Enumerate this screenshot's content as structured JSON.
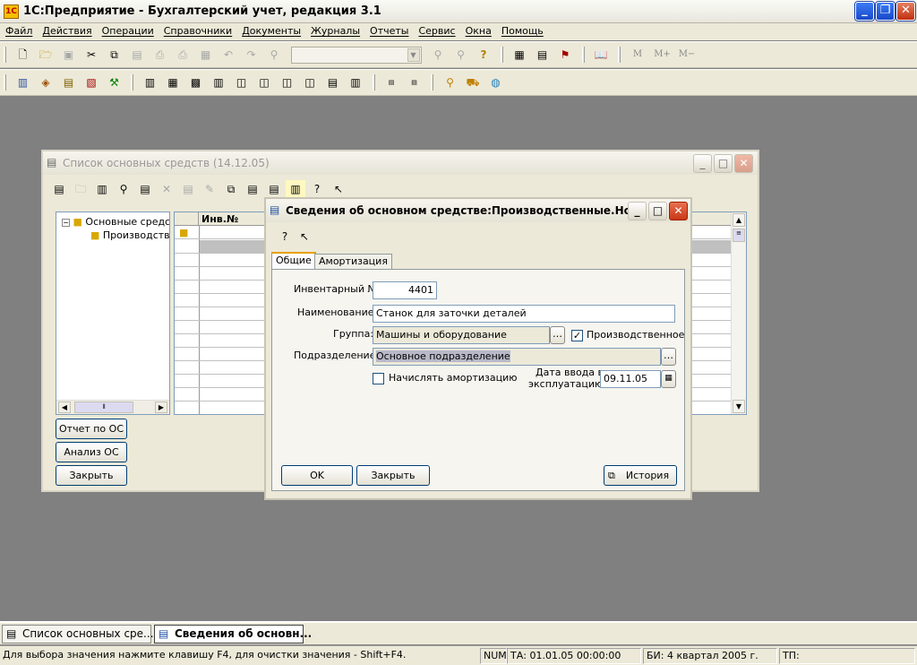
{
  "app": {
    "title": "1С:Предприятие - Бухгалтерский учет, редакция 3.1",
    "icon_text": "1С"
  },
  "menu": [
    "Файл",
    "Действия",
    "Операции",
    "Справочники",
    "Документы",
    "Журналы",
    "Отчеты",
    "Сервис",
    "Окна",
    "Помощь"
  ],
  "toolbar": {
    "memory_buttons": [
      "M",
      "M+",
      "M−"
    ]
  },
  "list_window": {
    "title": "Список основных средств (14.12.05)",
    "tree": {
      "root": "Основные средс",
      "child": "Производстве"
    },
    "grid_header": "Инв.№",
    "buttons": {
      "report": "Отчет по ОС",
      "analysis": "Анализ ОС",
      "close": "Закрыть"
    }
  },
  "detail_window": {
    "title": "Сведения об основном средстве:Производственные.Но...",
    "tabs": [
      "Общие",
      "Амортизация"
    ],
    "form": {
      "inv_label": "Инвентарный №",
      "inv_value": "4401",
      "name_label": "Наименование:",
      "name_value": "Станок для заточки деталей",
      "group_label": "Группа:",
      "group_value": "Машины и оборудование",
      "production_label": "Производственное",
      "production_checked": true,
      "division_label": "Подразделение:",
      "division_value": "Основное подразделение",
      "amort_label": "Начислять амортизацию",
      "amort_checked": false,
      "date_label_1": "Дата ввода в",
      "date_label_2": "эксплуатацию:",
      "date_value": "09.11.05"
    },
    "buttons": {
      "ok": "OK",
      "close": "Закрыть",
      "history": "История"
    }
  },
  "taskbar": [
    "Список основных сре...",
    "Сведения об основн..."
  ],
  "status": {
    "hint": "Для выбора значения нажмите клавишу F4, для очистки значения - Shift+F4.",
    "num": "NUM",
    "ta": "ТА: 01.01.05  00:00:00",
    "bi": "БИ: 4 квартал 2005 г.",
    "tp": "ТП:"
  },
  "colors": {
    "workspace": "#808080",
    "chrome": "#ece9d8",
    "selection": "#c0c0c0"
  }
}
